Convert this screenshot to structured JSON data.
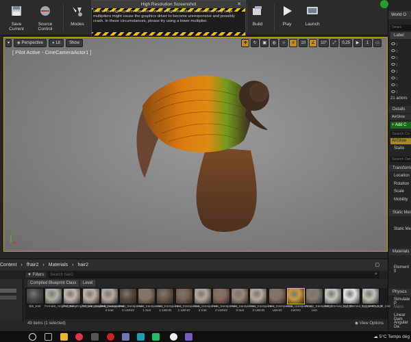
{
  "notification": {
    "title": "High Resolution Screenshot",
    "message": "Due to the high system requirements of a high resolution screenshot, very large multipliers might cause the graphics driver to become unresponsive and possibly crash. In these circumstances, please try using a lower multiplier.",
    "close_label": "✕"
  },
  "toolbar": {
    "save_label": "Save Current",
    "source_control_label": "Source Control",
    "modes_label": "Modes",
    "build_label": "Build",
    "play_label": "Play",
    "launch_label": "Launch"
  },
  "viewport": {
    "perspective_label": "Perspective",
    "lit_label": "Lit",
    "show_label": "Show",
    "pilot_text": "[ Pilot Active - CineCameraActor1 ]",
    "grid_snap": "10",
    "rot_snap": "10°",
    "scale_snap": "0,25",
    "cam_speed": "1"
  },
  "world_outliner": {
    "title": "World O",
    "search_placeholder": "Searc",
    "column_label": "Label",
    "actor_count": "21 actors",
    "details_tab": "Details",
    "selected_actor": "AirGlow",
    "add_button": "+ Add C",
    "search_comp": "Search Co",
    "component_name": "AirGlow",
    "static_label": "Statio",
    "search_details": "Search Det",
    "transform_section": "Transform",
    "location_label": "Location",
    "rotation_label": "Rotation",
    "scale_label": "Scale",
    "mobility_label": "Mobility",
    "static_mesh_section": "Static Mes",
    "static_mesh_label": "Static Me",
    "materials_section": "Materials",
    "element_label": "Element 0",
    "physics_section": "Physics",
    "simulate_label": "Simulate P",
    "mass_label": "Mass",
    "linear_label": "Linear Dam",
    "angular_label": "Angular Da"
  },
  "content_browser": {
    "breadcrumb": [
      "Content",
      "fhair2",
      "Materials",
      "hair2"
    ],
    "filters_label": "Filters",
    "search_value": "Search hair2",
    "chip_class": "Compiled Blueprint Class",
    "chip_level": "Level",
    "status": "49 items (1 selected)",
    "view_options": "View Options",
    "assets": [
      {
        "label": "Bis_Inst",
        "color": "#4a4a4a"
      },
      {
        "label": "Female_Angled_Base",
        "color": "#b7b0a8"
      },
      {
        "label": "Female_Angled_transparenc",
        "color": "#c4b7ae"
      },
      {
        "label": "Female_Angled_transparenc",
        "color": "#bdb2a8"
      },
      {
        "label": "Hair_transparenc 0 Inst",
        "color": "#b7aca3"
      },
      {
        "label": "Hair_transparenc 0 LWHO",
        "color": "#5a4a3c"
      },
      {
        "label": "Hair_transparenc 1 Inst",
        "color": "#8a7460"
      },
      {
        "label": "Hair_transparenc 1 LWHO",
        "color": "#6b5847"
      },
      {
        "label": "Hair_transparenc 1 LWHO",
        "color": "#7a6252"
      },
      {
        "label": "Hair_transparenc 2 Inst",
        "color": "#b5a89d"
      },
      {
        "label": "Hair_transparenc 2 LWHO",
        "color": "#8b6b59"
      },
      {
        "label": "Hair_transparenc 3 Inst",
        "color": "#9a8674"
      },
      {
        "label": "Hair_transparenc 3 LWHO",
        "color": "#b7ab9f"
      },
      {
        "label": "Hair_transparenc LWHO",
        "color": "#857060"
      },
      {
        "label": "Hair_transparenc LWHO",
        "color": "#c79a3e"
      },
      {
        "label": "Scalp_transparenc Inst",
        "color": "#867a70"
      },
      {
        "label": "Std_Cornea_L_Inst",
        "color": "#c9c3bc"
      },
      {
        "label": "Std_Cornea_L_LWHO_Inst",
        "color": "#e4e4e4"
      },
      {
        "label": "Std_Cornea_R_Inst",
        "color": "#c7c0b9"
      }
    ]
  },
  "taskbar": {
    "weather": "5°C",
    "weather_text": "Temps dég"
  }
}
